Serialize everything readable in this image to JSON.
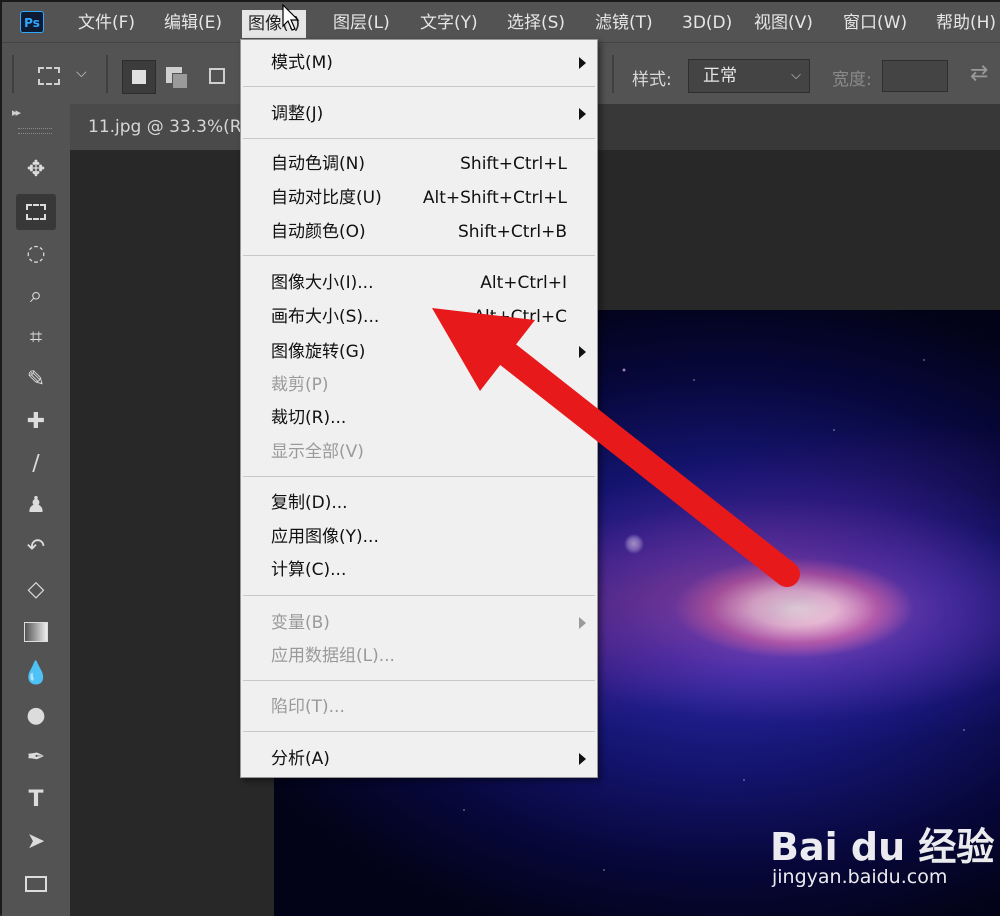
{
  "app": {
    "logo": "Ps"
  },
  "menubar": {
    "items": [
      {
        "label": "文件(F)"
      },
      {
        "label": "编辑(E)"
      },
      {
        "label": "图像(I)"
      },
      {
        "label": "图层(L)"
      },
      {
        "label": "文字(Y)"
      },
      {
        "label": "选择(S)"
      },
      {
        "label": "滤镜(T)"
      },
      {
        "label": "3D(D)"
      },
      {
        "label": "视图(V)"
      },
      {
        "label": "窗口(W)"
      },
      {
        "label": "帮助(H)"
      }
    ],
    "active_index": 2
  },
  "options_bar": {
    "style_label": "样式:",
    "style_value": "正常",
    "width_label": "宽度:",
    "width_value": ""
  },
  "document": {
    "tab_title": "11.jpg @ 33.3%(R"
  },
  "image_menu": {
    "items": [
      {
        "label": "模式(M)",
        "shortcut": "",
        "submenu": true,
        "disabled": false
      },
      {
        "label": "调整(J)",
        "shortcut": "",
        "submenu": true,
        "disabled": false
      },
      {
        "label": "自动色调(N)",
        "shortcut": "Shift+Ctrl+L",
        "submenu": false,
        "disabled": false
      },
      {
        "label": "自动对比度(U)",
        "shortcut": "Alt+Shift+Ctrl+L",
        "submenu": false,
        "disabled": false
      },
      {
        "label": "自动颜色(O)",
        "shortcut": "Shift+Ctrl+B",
        "submenu": false,
        "disabled": false
      },
      {
        "label": "图像大小(I)...",
        "shortcut": "Alt+Ctrl+I",
        "submenu": false,
        "disabled": false
      },
      {
        "label": "画布大小(S)...",
        "shortcut": "Alt+Ctrl+C",
        "submenu": false,
        "disabled": false
      },
      {
        "label": "图像旋转(G)",
        "shortcut": "",
        "submenu": true,
        "disabled": false
      },
      {
        "label": "裁剪(P)",
        "shortcut": "",
        "submenu": false,
        "disabled": true
      },
      {
        "label": "裁切(R)...",
        "shortcut": "",
        "submenu": false,
        "disabled": false
      },
      {
        "label": "显示全部(V)",
        "shortcut": "",
        "submenu": false,
        "disabled": true
      },
      {
        "label": "复制(D)...",
        "shortcut": "",
        "submenu": false,
        "disabled": false
      },
      {
        "label": "应用图像(Y)...",
        "shortcut": "",
        "submenu": false,
        "disabled": false
      },
      {
        "label": "计算(C)...",
        "shortcut": "",
        "submenu": false,
        "disabled": false
      },
      {
        "label": "变量(B)",
        "shortcut": "",
        "submenu": true,
        "disabled": true
      },
      {
        "label": "应用数据组(L)...",
        "shortcut": "",
        "submenu": false,
        "disabled": true
      },
      {
        "label": "陷印(T)...",
        "shortcut": "",
        "submenu": false,
        "disabled": true
      },
      {
        "label": "分析(A)",
        "shortcut": "",
        "submenu": true,
        "disabled": false
      }
    ]
  },
  "tools": [
    {
      "icon": "move-icon"
    },
    {
      "icon": "rectangular-marquee-icon"
    },
    {
      "icon": "lasso-icon"
    },
    {
      "icon": "quick-selection-icon"
    },
    {
      "icon": "crop-icon"
    },
    {
      "icon": "eyedropper-icon"
    },
    {
      "icon": "healing-brush-icon"
    },
    {
      "icon": "brush-icon"
    },
    {
      "icon": "clone-stamp-icon"
    },
    {
      "icon": "history-brush-icon"
    },
    {
      "icon": "eraser-icon"
    },
    {
      "icon": "gradient-icon"
    },
    {
      "icon": "blur-icon"
    },
    {
      "icon": "dodge-icon"
    },
    {
      "icon": "pen-icon"
    },
    {
      "icon": "type-icon"
    },
    {
      "icon": "path-selection-icon"
    },
    {
      "icon": "rectangle-shape-icon"
    }
  ],
  "annotation": {
    "color": "#e8191b"
  },
  "watermark": {
    "brand": "Bai du 经验",
    "url": "jingyan.baidu.com"
  }
}
